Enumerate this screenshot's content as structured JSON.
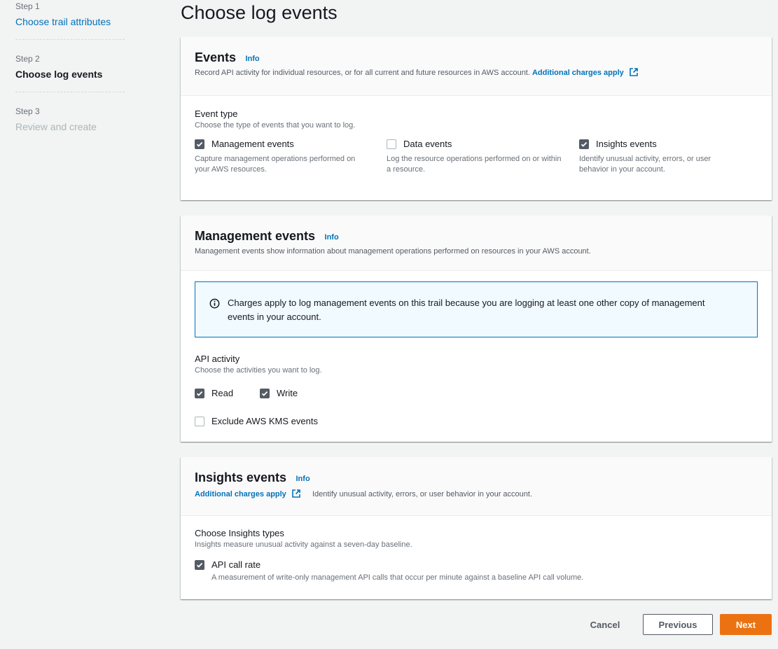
{
  "wizard": {
    "steps": [
      {
        "number": "Step 1",
        "title": "Choose trail attributes",
        "state": "link"
      },
      {
        "number": "Step 2",
        "title": "Choose log events",
        "state": "current"
      },
      {
        "number": "Step 3",
        "title": "Review and create",
        "state": "disabled"
      }
    ]
  },
  "page": {
    "title": "Choose log events"
  },
  "events_panel": {
    "title": "Events",
    "info": "Info",
    "description": "Record API activity for individual resources, or for all current and future resources in AWS account.",
    "charges_link": "Additional charges apply",
    "event_type": {
      "label": "Event type",
      "hint": "Choose the type of events that you want to log.",
      "options": [
        {
          "label": "Management events",
          "checked": true,
          "description": "Capture management operations performed on your AWS resources."
        },
        {
          "label": "Data events",
          "checked": false,
          "description": "Log the resource operations performed on or within a resource."
        },
        {
          "label": "Insights events",
          "checked": true,
          "description": "Identify unusual activity, errors, or user behavior in your account."
        }
      ]
    }
  },
  "management_panel": {
    "title": "Management events",
    "info": "Info",
    "description": "Management events show information about management operations performed on resources in your AWS account.",
    "alert_text": "Charges apply to log management events on this trail because you are logging at least one other copy of management events in your account.",
    "api_activity": {
      "label": "API activity",
      "hint": "Choose the activities you want to log.",
      "read": {
        "label": "Read",
        "checked": true
      },
      "write": {
        "label": "Write",
        "checked": true
      }
    },
    "exclude_kms": {
      "label": "Exclude AWS KMS events",
      "checked": false
    }
  },
  "insights_panel": {
    "title": "Insights events",
    "info": "Info",
    "charges_link": "Additional charges apply",
    "description": "Identify unusual activity, errors, or user behavior in your account.",
    "types": {
      "label": "Choose Insights types",
      "hint": "Insights measure unusual activity against a seven-day baseline.",
      "api_call_rate": {
        "label": "API call rate",
        "checked": true,
        "description": "A measurement of write-only management API calls that occur per minute against a baseline API call volume."
      }
    }
  },
  "footer": {
    "cancel": "Cancel",
    "previous": "Previous",
    "next": "Next"
  },
  "colors": {
    "accent_orange": "#ec7211",
    "link_blue": "#0073bb",
    "alert_border": "#0073bb",
    "alert_bg": "#f1faff",
    "checkbox_checked": "#545b64"
  }
}
